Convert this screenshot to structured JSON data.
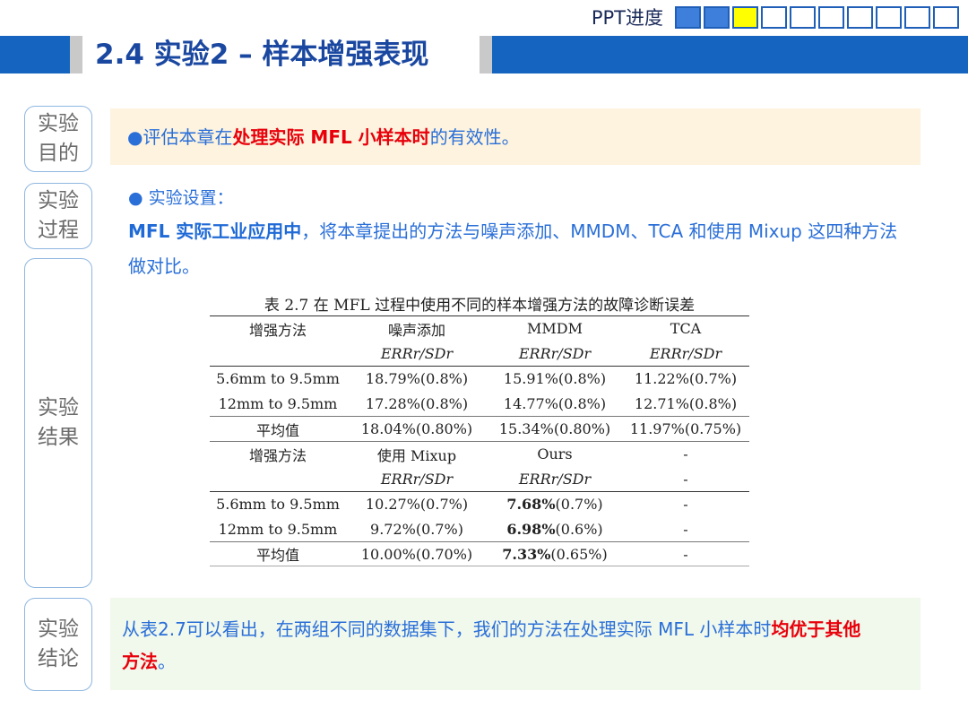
{
  "header": {
    "progress_label": "PPT进度",
    "progress": {
      "completed": 2,
      "current": 3,
      "total": 10
    },
    "colors": {
      "done": "#3f7fdc",
      "current": "#ffff00",
      "title_bar": "#1565c0"
    }
  },
  "page_title": "2.4 实验2 – 样本增强表现",
  "sections": {
    "purpose": {
      "label": "实验目的",
      "bullet": "●",
      "text_pre": "评估本章在",
      "text_bold": "处理实际 MFL 小样本时",
      "text_post": "的有效性。"
    },
    "process": {
      "label": "实验过程",
      "bullet": "● 实验设置：",
      "line1_bold": "MFL 实际工业应用中",
      "line1_rest": "，将本章提出的方法与噪声添加、MMDM、TCA 和使用 Mixup 这四种方法",
      "line2": "做对比。"
    },
    "results": {
      "label": "实验结果",
      "table_caption": "表 2.7 在 MFL 过程中使用不同的样本增强方法的故障诊断误差",
      "block1": {
        "headers": [
          "增强方法",
          "噪声添加",
          "MMDM",
          "TCA"
        ],
        "metrics": [
          "",
          "ERRr/SDr",
          "ERRr/SDr",
          "ERRr/SDr"
        ],
        "rows": [
          [
            "5.6mm to 9.5mm",
            "18.79%(0.8%)",
            "15.91%(0.8%)",
            "11.22%(0.7%)"
          ],
          [
            "12mm to 9.5mm",
            "17.28%(0.8%)",
            "14.77%(0.8%)",
            "12.71%(0.8%)"
          ],
          [
            "平均值",
            "18.04%(0.80%)",
            "15.34%(0.80%)",
            "11.97%(0.75%)"
          ]
        ]
      },
      "block2": {
        "headers": [
          "增强方法",
          "使用 Mixup",
          "Ours",
          "-"
        ],
        "metrics": [
          "",
          "ERRr/SDr",
          "ERRr/SDr",
          "-"
        ],
        "rows": [
          [
            "5.6mm to 9.5mm",
            "10.27%(0.7%)",
            "7.68%",
            "(0.7%)",
            "-"
          ],
          [
            "12mm to 9.5mm",
            "9.72%(0.7%)",
            "6.98%",
            "(0.6%)",
            "-"
          ],
          [
            "平均值",
            "10.00%(0.70%)",
            "7.33%",
            "(0.65%)",
            "-"
          ]
        ]
      }
    },
    "conclusion": {
      "label": "实验结论",
      "line1": "从表2.7可以看出，在两组不同的数据集下，我们的方法在处理实际 MFL 小样本时",
      "line1_bold": "均优于其他",
      "line2_bold": "方法",
      "line2_end": "。"
    }
  }
}
